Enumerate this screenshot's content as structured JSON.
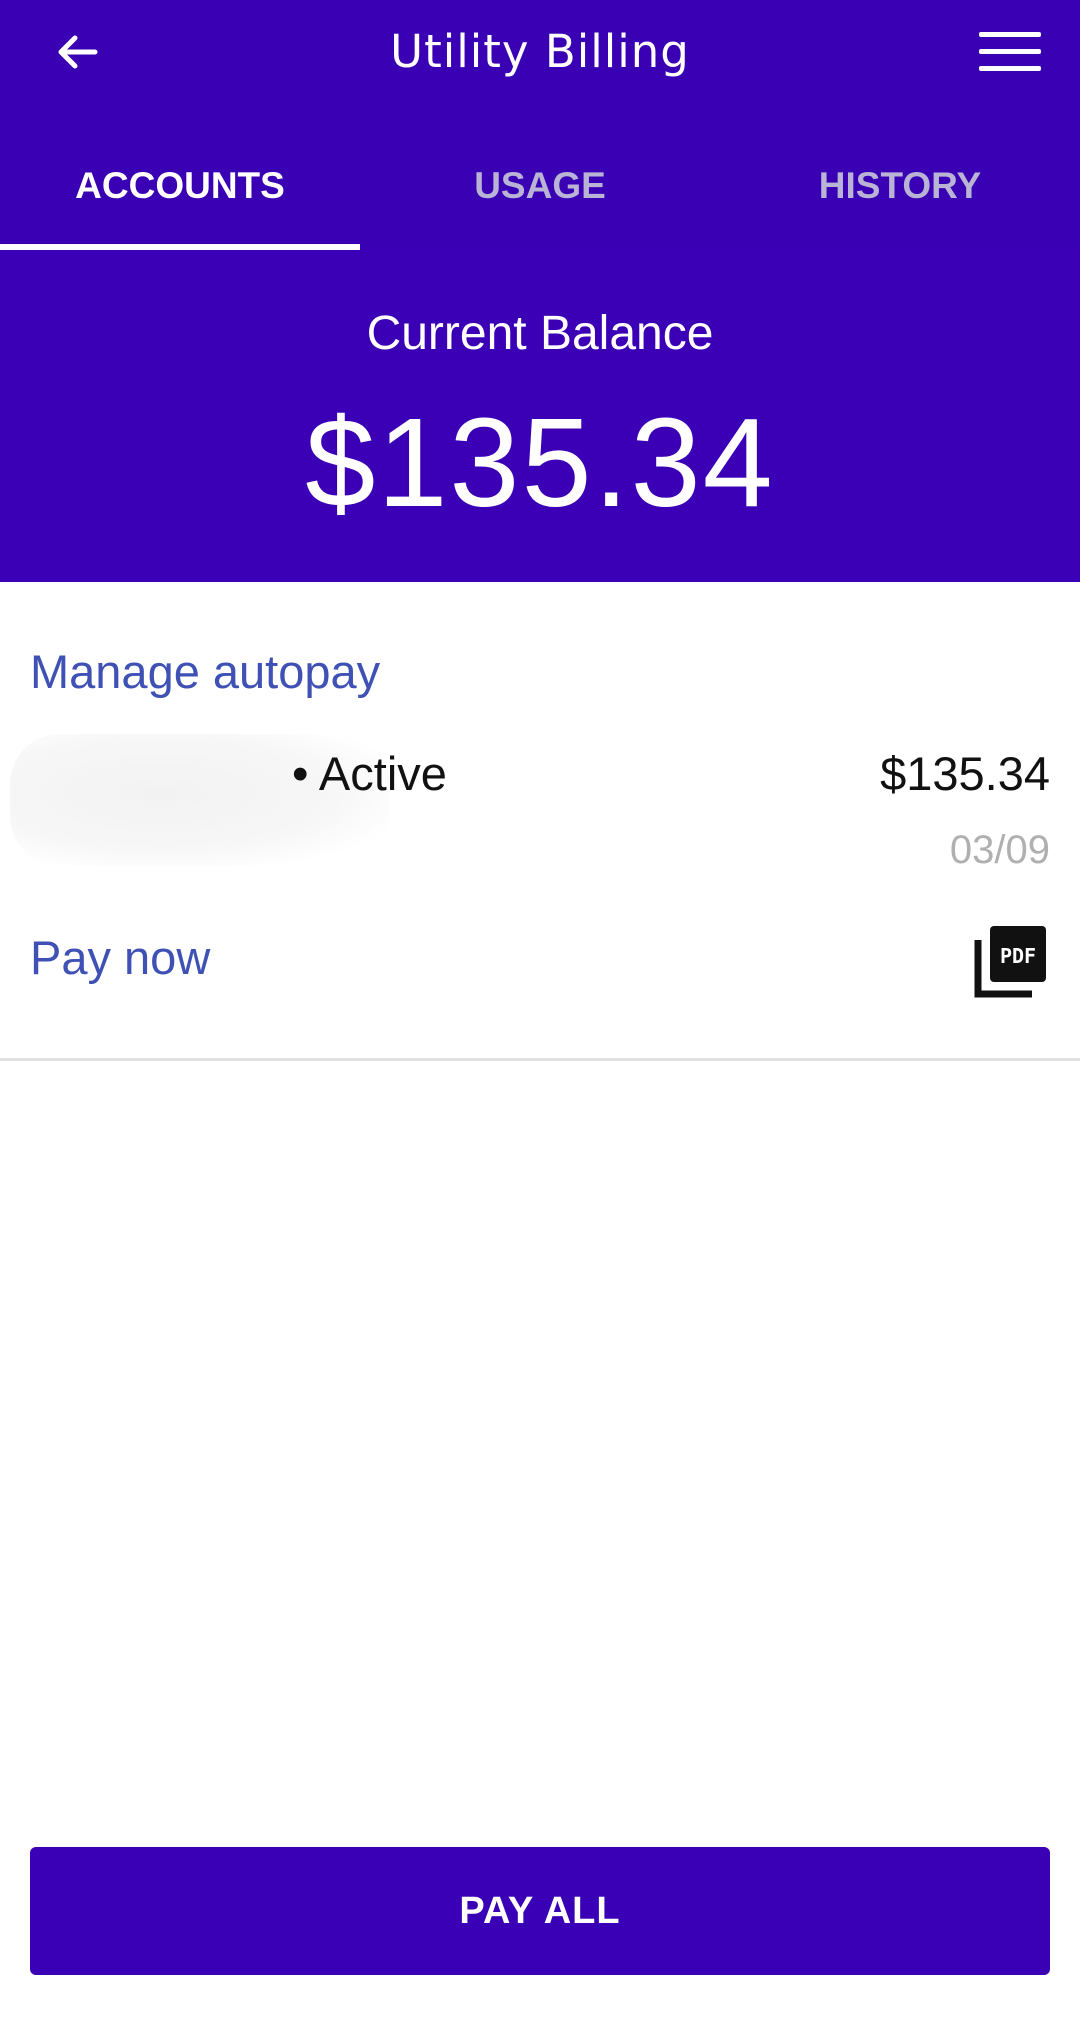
{
  "header": {
    "title": "Utility Billing",
    "back_icon": "arrow-left-icon",
    "menu_icon": "hamburger-menu-icon"
  },
  "tabs": [
    {
      "label": "ACCOUNTS",
      "active": true
    },
    {
      "label": "USAGE",
      "active": false
    },
    {
      "label": "HISTORY",
      "active": false
    }
  ],
  "balance": {
    "label": "Current Balance",
    "amount": "$135.34"
  },
  "account": {
    "manage_label": "Manage autopay",
    "status": "• Active",
    "amount": "$135.34",
    "date": "03/09",
    "pay_now_label": "Pay now",
    "pdf_icon": "pdf-icon"
  },
  "footer": {
    "pay_all_label": "PAY ALL"
  },
  "colors": {
    "primary": "#3a00b3",
    "link": "#3f51b5",
    "muted": "#b0b0b0"
  }
}
